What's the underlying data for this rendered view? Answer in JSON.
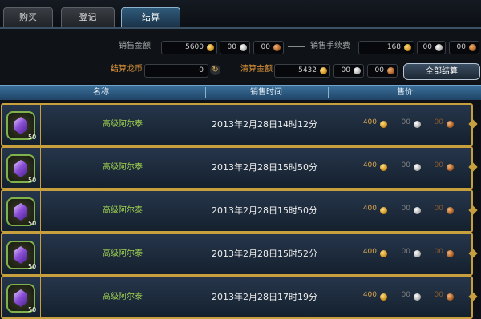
{
  "tabs": [
    {
      "label": "购买",
      "active": false
    },
    {
      "label": "登记",
      "active": false
    },
    {
      "label": "结算",
      "active": true
    }
  ],
  "settlement": {
    "sales_amount_label": "销售金额",
    "sales_amount_gold": "5600",
    "sales_amount_silver": "00",
    "sales_amount_bronze": "00",
    "fee_label": "销售手续费",
    "fee_gold": "168",
    "fee_silver": "00",
    "fee_bronze": "00",
    "dragon_coin_label": "结算龙币",
    "dragon_coin_value": "0",
    "clear_amount_label": "清算金额",
    "clear_gold": "5432",
    "clear_silver": "00",
    "clear_bronze": "00",
    "settle_all_label": "全部结算"
  },
  "table": {
    "columns": [
      "名称",
      "销售时间",
      "售价"
    ],
    "rows": [
      {
        "qty": "50",
        "name": "高级阿尔泰",
        "time": "2013年2月28日14时12分",
        "gold": "400",
        "silver": "00",
        "bronze": "00"
      },
      {
        "qty": "50",
        "name": "高级阿尔泰",
        "time": "2013年2月28日15时50分",
        "gold": "400",
        "silver": "00",
        "bronze": "00"
      },
      {
        "qty": "50",
        "name": "高级阿尔泰",
        "time": "2013年2月28日15时50分",
        "gold": "400",
        "silver": "00",
        "bronze": "00"
      },
      {
        "qty": "50",
        "name": "高级阿尔泰",
        "time": "2013年2月28日15时52分",
        "gold": "400",
        "silver": "00",
        "bronze": "00"
      },
      {
        "qty": "50",
        "name": "高级阿尔泰",
        "time": "2013年2月28日17时19分",
        "gold": "400",
        "silver": "00",
        "bronze": "00"
      }
    ]
  },
  "colors": {
    "accent_gold": "#c79f3c",
    "item_name": "#9ed14f",
    "label_orange": "#e59a3a",
    "header_blue": "#2f5a7a"
  },
  "icons": {
    "item_icon": "purple-gem-icon",
    "gold_coin": "gold-coin-icon",
    "silver_coin": "silver-coin-icon",
    "bronze_coin": "bronze-coin-icon",
    "refresh": "refresh-icon"
  }
}
